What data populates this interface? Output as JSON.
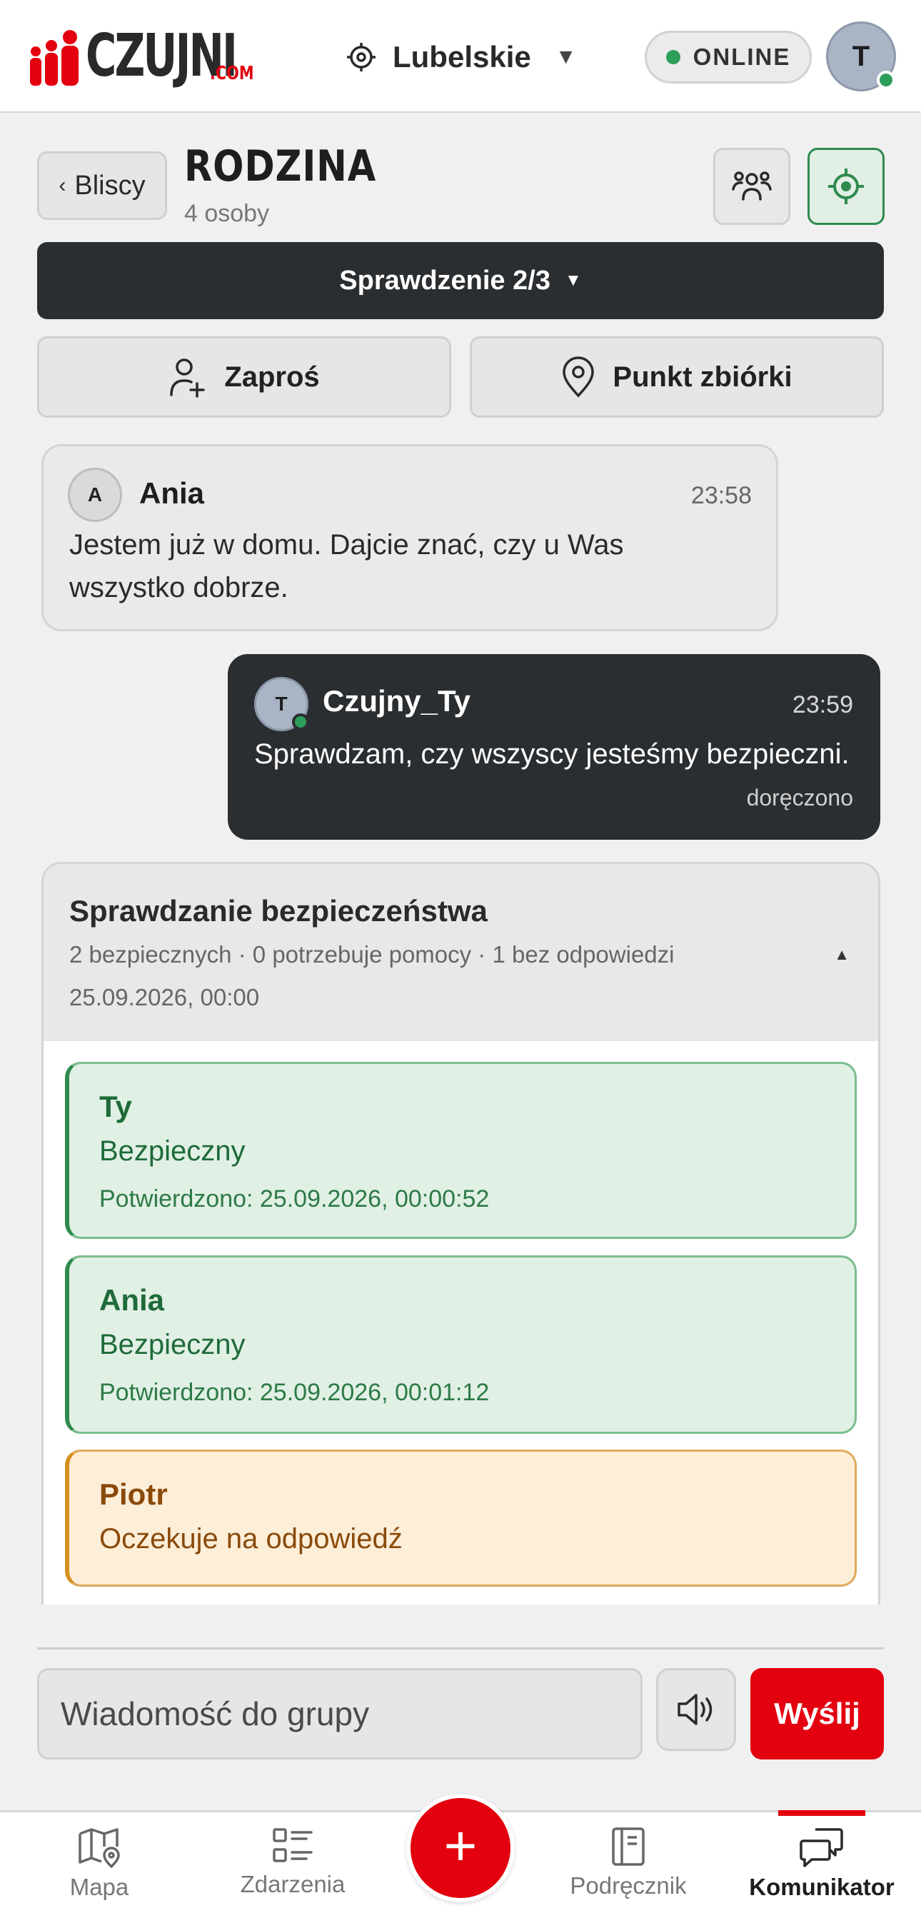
{
  "app": {
    "logo_text": "CZUJNI",
    "logo_suffix": ".COM",
    "region": "Lubelskie",
    "connection_status": "ONLINE",
    "user_initial": "T",
    "colors": {
      "brand_red": "#e3000f",
      "online_green": "#2e9e5b",
      "dark": "#2b2e31"
    }
  },
  "group": {
    "back_label": "Bliscy",
    "title": "RODZINA",
    "member_count": "4 osoby",
    "check_label": "Sprawdzenie 2/3",
    "invite_label": "Zaproś",
    "gather_label": "Punkt zbiórki"
  },
  "messages": [
    {
      "initial": "A",
      "sender": "Ania",
      "time": "23:58",
      "text": "Jestem już w domu. Dajcie znać, czy u Was wszystko dobrze."
    },
    {
      "initial": "T",
      "sender": "Czujny_Ty",
      "time": "23:59",
      "text": "Sprawdzam, czy wszyscy jesteśmy bezpieczni.",
      "status": "doręczono"
    }
  ],
  "safety_check": {
    "title": "Sprawdzanie bezpieczeństwa",
    "summary": "2 bezpiecznych · 0 potrzebuje pomocy · 1 bez odpowiedzi",
    "date": "25.09.2026, 00:00",
    "entries": [
      {
        "name": "Ty",
        "status": "Bezpieczny",
        "confirmed": "Potwierdzono: 25.09.2026, 00:00:52"
      },
      {
        "name": "Ania",
        "status": "Bezpieczny",
        "confirmed": "Potwierdzono: 25.09.2026, 00:01:12"
      },
      {
        "name": "Piotr",
        "status": "Oczekuje na odpowiedź"
      }
    ]
  },
  "composer": {
    "placeholder": "Wiadomość do grupy",
    "send_label": "Wyślij"
  },
  "nav": {
    "items": [
      {
        "label": "Mapa",
        "icon": "map-icon"
      },
      {
        "label": "Zdarzenia",
        "icon": "list-icon"
      },
      {
        "label": "Podręcznik",
        "icon": "book-icon"
      },
      {
        "label": "Komunikator",
        "icon": "chat-icon"
      }
    ],
    "active": "Komunikator"
  }
}
